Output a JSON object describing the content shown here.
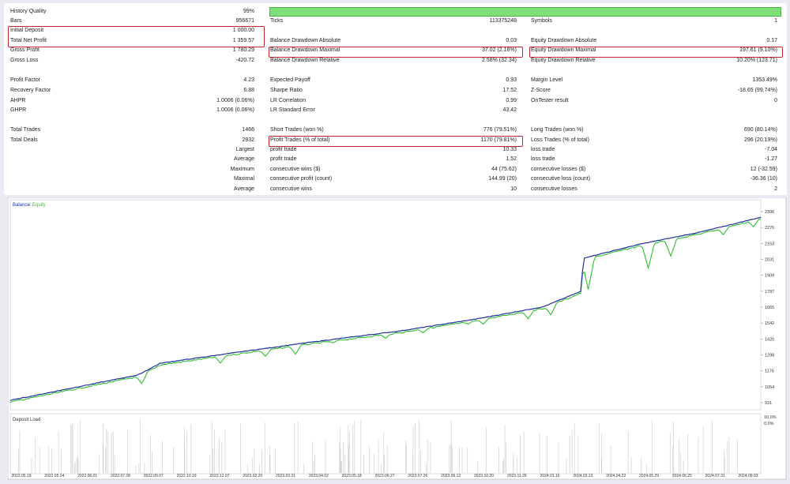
{
  "report": {
    "rows": [
      {
        "id": "history-quality",
        "label": "History Quality",
        "value": "99%"
      },
      {
        "id": "bars",
        "label": "Bars",
        "value": "956671",
        "c2label": "Ticks",
        "c2value": "113375248",
        "c3label": "Symbols",
        "c3value": "1"
      },
      {
        "id": "initial-deposit",
        "label": "Initial Deposit",
        "value": "1 000.00"
      },
      {
        "id": "total-net-profit",
        "label": "Total Net Profit",
        "value": "1 359.57",
        "c2label": "Balance Drawdown Absolute",
        "c2value": "0.03",
        "c3label": "Equity Drawdown Absolute",
        "c3value": "0.17"
      },
      {
        "id": "gross-profit",
        "label": "Gross Profit",
        "value": "1 780.29",
        "c2label": "Balance Drawdown Maximal",
        "c2value": "37.02 (2.16%)",
        "c3label": "Equity Drawdown Maximal",
        "c3value": "197.61 (9.10%)"
      },
      {
        "id": "gross-loss",
        "label": "Gross Loss",
        "value": "-420.72",
        "c2label": "Balance Drawdown Relative",
        "c2value": "2.58% (32.34)",
        "c3label": "Equity Drawdown Relative",
        "c3value": "10.20% (123.71)"
      },
      {
        "id": "spacer-1",
        "label": "",
        "value": ""
      },
      {
        "id": "profit-factor",
        "label": "Profit Factor",
        "value": "4.23",
        "c2label": "Expected Payoff",
        "c2value": "0.93",
        "c3label": "Margin Level",
        "c3value": "1353.49%"
      },
      {
        "id": "recovery-factor",
        "label": "Recovery Factor",
        "value": "6.88",
        "c2label": "Sharpe Ratio",
        "c2value": "17.52",
        "c3label": "Z-Score",
        "c3value": "-18.65 (99.74%)"
      },
      {
        "id": "ahpr",
        "label": "AHPR",
        "value": "1.0006 (0.06%)",
        "c2label": "LR Correlation",
        "c2value": "0.99",
        "c3label": "OnTester result",
        "c3value": "0"
      },
      {
        "id": "ghpr",
        "label": "GHPR",
        "value": "1.0006 (0.06%)",
        "c2label": "LR Standard Error",
        "c2value": "43.42"
      },
      {
        "id": "spacer-2",
        "label": "",
        "value": ""
      },
      {
        "id": "total-trades",
        "label": "Total Trades",
        "value": "1466",
        "c2label": "Short Trades (won %)",
        "c2value": "776 (79.51%)",
        "c3label": "Long Trades (won %)",
        "c3value": "690 (80.14%)"
      },
      {
        "id": "total-deals",
        "label": "Total Deals",
        "value": "2932",
        "c2label": "Profit Trades (% of total)",
        "c2value": "1170 (79.81%)",
        "c3label": "Loss Trades (% of total)",
        "c3value": "296 (20.19%)"
      },
      {
        "id": "largest",
        "rlabel": "Largest",
        "c2label": "profit trade",
        "c2value": "10.33",
        "c3label": "loss trade",
        "c3value": "-7.04"
      },
      {
        "id": "average",
        "rlabel": "Average",
        "c2label": "profit trade",
        "c2value": "1.52",
        "c3label": "loss trade",
        "c3value": "-1.27"
      },
      {
        "id": "maximum",
        "rlabel": "Maximum",
        "c2label": "consecutive wins ($)",
        "c2value": "44 (75.62)",
        "c3label": "consecutive losses ($)",
        "c3value": "12 (-32.59)"
      },
      {
        "id": "maximal",
        "rlabel": "Maximal",
        "c2label": "consecutive profit (count)",
        "c2value": "144.99 (20)",
        "c3label": "consecutive loss (count)",
        "c3value": "-36.36 (10)"
      },
      {
        "id": "average-consecutive",
        "rlabel": "Average",
        "c2label": "consecutive wins",
        "c2value": "10",
        "c3label": "consecutive losses",
        "c3value": "2"
      }
    ]
  },
  "chart_data": {
    "type": "line",
    "title": "",
    "xlabel": "",
    "ylabel": "",
    "legend": [
      "Balance",
      "Equity"
    ],
    "colors": {
      "balance": "#1f2f9e",
      "equity": "#2fbf2f"
    },
    "y_ticks": [
      "2396",
      "2276",
      "2153",
      "2031",
      "1909",
      "1787",
      "1665",
      "1542",
      "1420",
      "1298",
      "1176",
      "1054",
      "931"
    ],
    "ylim": [
      931,
      2396
    ],
    "x_ticks": [
      "2022.05.19",
      "2022.05.24",
      "2022.06.01",
      "2022.07.28",
      "2022.09.07",
      "2022.10.19",
      "2022.12.07",
      "2023.02.20",
      "2023.03.21",
      "2023.04.02",
      "2023.05.18",
      "2023.06.27",
      "2023.07.26",
      "2023.09.12",
      "2023.10.20",
      "2023.11.29",
      "2024.01.16",
      "2024.03.13",
      "2024.04.22",
      "2024.05.29",
      "2024.06.25",
      "2024.07.31",
      "2024.09.03"
    ],
    "balance_points": [
      [
        0,
        960
      ],
      [
        8,
        1050
      ],
      [
        17,
        1150
      ],
      [
        20,
        1238
      ],
      [
        30,
        1318
      ],
      [
        40,
        1395
      ],
      [
        52,
        1480
      ],
      [
        62,
        1568
      ],
      [
        71,
        1660
      ],
      [
        76,
        1775
      ],
      [
        76.4,
        2025
      ],
      [
        84,
        2130
      ],
      [
        92,
        2220
      ],
      [
        100,
        2330
      ]
    ],
    "equity_dips": [
      [
        17.5,
        1085
      ],
      [
        28,
        1240
      ],
      [
        34,
        1290
      ],
      [
        38,
        1305
      ],
      [
        43,
        1390
      ],
      [
        50,
        1425
      ],
      [
        55,
        1465
      ],
      [
        61,
        1530
      ],
      [
        63,
        1530
      ],
      [
        69,
        1570
      ],
      [
        72,
        1600
      ],
      [
        77,
        1790
      ],
      [
        85,
        1950
      ],
      [
        88,
        2040
      ],
      [
        95,
        2200
      ],
      [
        99,
        2260
      ]
    ]
  },
  "deposit_load": {
    "label": "Deposit Load",
    "y_ticks": [
      "10.0%",
      "0.0%"
    ]
  }
}
